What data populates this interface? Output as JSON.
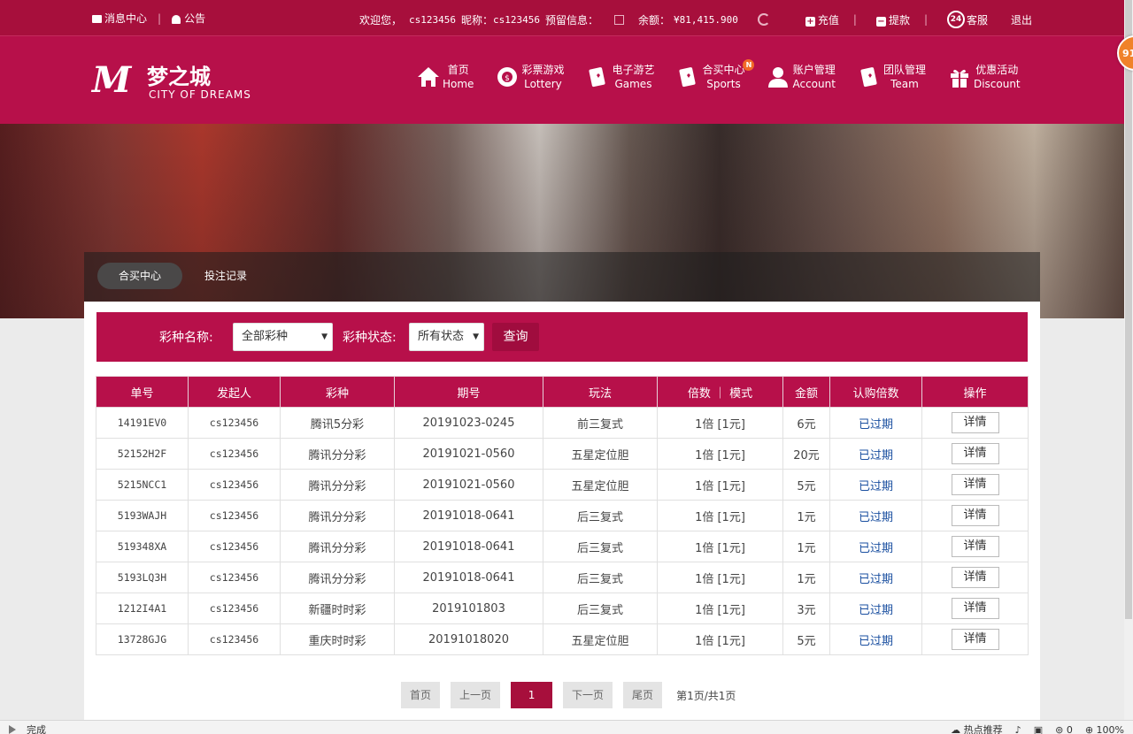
{
  "topbar": {
    "messages": "消息中心",
    "notice": "公告",
    "welcome": "欢迎您，",
    "username": "cs123456",
    "nickname_label": "昵称：",
    "nickname": "cs123456",
    "reserved_label": "预留信息：",
    "balance_label": "余额：",
    "balance": "¥81,415.900",
    "recharge": "充值",
    "withdraw": "提款",
    "service": "客服",
    "service_icon": "24",
    "logout": "退出"
  },
  "logo": {
    "mark": "M",
    "cn": "梦之城",
    "en": "CITY OF DREAMS"
  },
  "nav": [
    {
      "cn": "首页",
      "en": "Home",
      "icon": "home-icon"
    },
    {
      "cn": "彩票游戏",
      "en": "Lottery",
      "icon": "lottery-icon"
    },
    {
      "cn": "电子游艺",
      "en": "Games",
      "icon": "card-icon"
    },
    {
      "cn": "合买中心",
      "en": "Sports",
      "icon": "card-icon",
      "badge": "N"
    },
    {
      "cn": "账户管理",
      "en": "Account",
      "icon": "user-icon"
    },
    {
      "cn": "团队管理",
      "en": "Team",
      "icon": "card-icon"
    },
    {
      "cn": "优惠活动",
      "en": "Discount",
      "icon": "gift-icon"
    }
  ],
  "tabs": {
    "active": "合买中心",
    "second": "投注记录"
  },
  "filter": {
    "lottery_label": "彩种名称:",
    "lottery_value": "全部彩种",
    "status_label": "彩种状态:",
    "status_value": "所有状态",
    "query": "查询"
  },
  "table": {
    "headers": [
      "单号",
      "发起人",
      "彩种",
      "期号",
      "玩法",
      "倍数  ｜  模式",
      "金额",
      "认购倍数",
      "操作"
    ],
    "rows": [
      [
        "14191EV0",
        "cs123456",
        "腾讯5分彩",
        "20191023-0245",
        "前三复式",
        "1倍 [1元]",
        "6元",
        "已过期",
        "详情"
      ],
      [
        "52152H2F",
        "cs123456",
        "腾讯分分彩",
        "20191021-0560",
        "五星定位胆",
        "1倍 [1元]",
        "20元",
        "已过期",
        "详情"
      ],
      [
        "5215NCC1",
        "cs123456",
        "腾讯分分彩",
        "20191021-0560",
        "五星定位胆",
        "1倍 [1元]",
        "5元",
        "已过期",
        "详情"
      ],
      [
        "5193WAJH",
        "cs123456",
        "腾讯分分彩",
        "20191018-0641",
        "后三复式",
        "1倍 [1元]",
        "1元",
        "已过期",
        "详情"
      ],
      [
        "519348XA",
        "cs123456",
        "腾讯分分彩",
        "20191018-0641",
        "后三复式",
        "1倍 [1元]",
        "1元",
        "已过期",
        "详情"
      ],
      [
        "5193LQ3H",
        "cs123456",
        "腾讯分分彩",
        "20191018-0641",
        "后三复式",
        "1倍 [1元]",
        "1元",
        "已过期",
        "详情"
      ],
      [
        "1212I4A1",
        "cs123456",
        "新疆时时彩",
        "2019101803",
        "后三复式",
        "1倍 [1元]",
        "3元",
        "已过期",
        "详情"
      ],
      [
        "13728GJG",
        "cs123456",
        "重庆时时彩",
        "20191018020",
        "五星定位胆",
        "1倍 [1元]",
        "5元",
        "已过期",
        "详情"
      ]
    ]
  },
  "pager": {
    "first": "首页",
    "prev": "上一页",
    "current": "1",
    "next": "下一页",
    "last": "尾页",
    "info": "第1页/共1页"
  },
  "float_badge": "91",
  "statusbar": {
    "done": "完成",
    "hot": "热点推荐",
    "counter": "0",
    "zoom": "100%"
  }
}
